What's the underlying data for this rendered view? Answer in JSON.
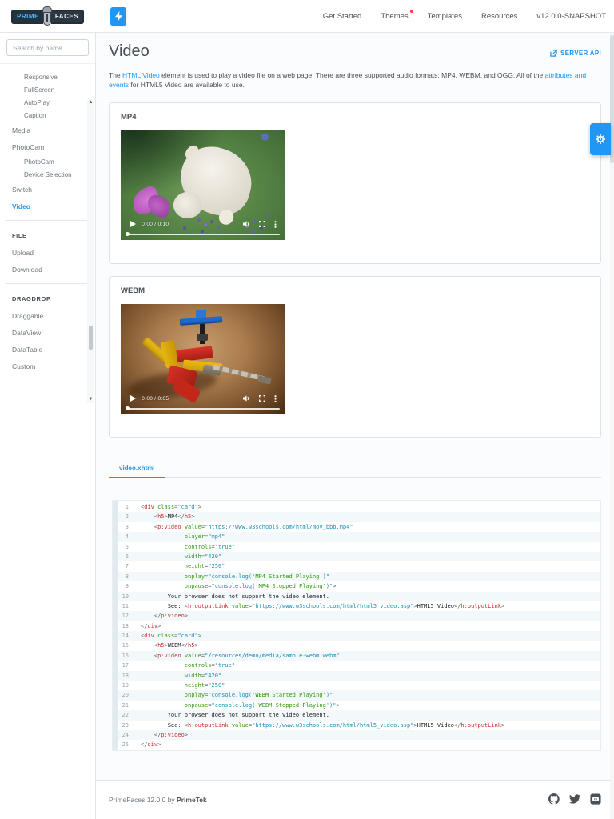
{
  "topbar": {
    "logo": {
      "prime": "PRIME",
      "faces": "FACES"
    },
    "nav": [
      {
        "label": "Get Started"
      },
      {
        "label": "Themes",
        "badge": true
      },
      {
        "label": "Templates"
      },
      {
        "label": "Resources"
      },
      {
        "label": "v12.0.0-SNAPSHOT"
      }
    ]
  },
  "sidebar": {
    "search_placeholder": "Search by name...",
    "items": [
      {
        "type": "sub",
        "label": "Responsive"
      },
      {
        "type": "sub",
        "label": "FullScreen"
      },
      {
        "type": "sub",
        "label": "AutoPlay"
      },
      {
        "type": "sub",
        "label": "Caption"
      },
      {
        "type": "top",
        "label": "Media"
      },
      {
        "type": "top",
        "label": "PhotoCam"
      },
      {
        "type": "sub",
        "label": "PhotoCam"
      },
      {
        "type": "sub",
        "label": "Device Selection"
      },
      {
        "type": "top",
        "label": "Switch"
      },
      {
        "type": "top",
        "label": "Video",
        "active": true
      },
      {
        "type": "divider"
      },
      {
        "type": "section",
        "label": "FILE"
      },
      {
        "type": "top",
        "label": "Upload"
      },
      {
        "type": "top",
        "label": "Download"
      },
      {
        "type": "divider"
      },
      {
        "type": "section",
        "label": "DRAGDROP"
      },
      {
        "type": "top",
        "label": "Draggable"
      },
      {
        "type": "top",
        "label": "DataView"
      },
      {
        "type": "top",
        "label": "DataTable"
      },
      {
        "type": "top",
        "label": "Custom"
      }
    ]
  },
  "page": {
    "title": "Video",
    "server_api_label": "SERVER API",
    "description_segments": [
      {
        "text": "The ",
        "link": false
      },
      {
        "text": "HTML Video",
        "link": true
      },
      {
        "text": " element is used to play a video file on a web page. There are three supported audio formats: MP4, WEBM, and OGG. All of the ",
        "link": false
      },
      {
        "text": "attributes and events",
        "link": true
      },
      {
        "text": " for HTML5 Video are available to use.",
        "link": false
      }
    ]
  },
  "cards": [
    {
      "title": "MP4",
      "time": "0:00 / 0:10"
    },
    {
      "title": "WEBM",
      "time": "0:00 / 0:05"
    }
  ],
  "code_section": {
    "tab": "video.xhtml",
    "lines": [
      [
        [
          "p",
          "<"
        ],
        [
          "t",
          "div"
        ],
        [
          "x",
          " "
        ],
        [
          "a",
          "class"
        ],
        [
          "p",
          "="
        ],
        [
          "v",
          "\"card\""
        ],
        [
          "p",
          ">"
        ]
      ],
      [
        [
          "x",
          "    "
        ],
        [
          "p",
          "<"
        ],
        [
          "t",
          "h5"
        ],
        [
          "p",
          ">"
        ],
        [
          "x",
          "MP4"
        ],
        [
          "p",
          "</"
        ],
        [
          "t",
          "h5"
        ],
        [
          "p",
          ">"
        ]
      ],
      [
        [
          "x",
          "    "
        ],
        [
          "p",
          "<"
        ],
        [
          "t",
          "p:video"
        ],
        [
          "x",
          " "
        ],
        [
          "a",
          "value"
        ],
        [
          "p",
          "="
        ],
        [
          "v",
          "\"https://www.w3schools.com/html/mov_bbb.mp4\""
        ]
      ],
      [
        [
          "x",
          "             "
        ],
        [
          "a",
          "player"
        ],
        [
          "p",
          "="
        ],
        [
          "v",
          "\"mp4\""
        ]
      ],
      [
        [
          "x",
          "             "
        ],
        [
          "a",
          "controls"
        ],
        [
          "p",
          "="
        ],
        [
          "v",
          "\"true\""
        ]
      ],
      [
        [
          "x",
          "             "
        ],
        [
          "a",
          "width"
        ],
        [
          "p",
          "="
        ],
        [
          "v",
          "\"420\""
        ]
      ],
      [
        [
          "x",
          "             "
        ],
        [
          "a",
          "height"
        ],
        [
          "p",
          "="
        ],
        [
          "v",
          "\"250\""
        ]
      ],
      [
        [
          "x",
          "             "
        ],
        [
          "a",
          "onplay"
        ],
        [
          "p",
          "="
        ],
        [
          "v",
          "\"console.log("
        ],
        [
          "s",
          "'MP4 Started Playing'"
        ],
        [
          "v",
          ")\""
        ]
      ],
      [
        [
          "x",
          "             "
        ],
        [
          "a",
          "onpause"
        ],
        [
          "p",
          "="
        ],
        [
          "v",
          "\"console.log("
        ],
        [
          "s",
          "'MP4 Stopped Playing'"
        ],
        [
          "v",
          ")\""
        ],
        [
          "p",
          ">"
        ]
      ],
      [
        [
          "x",
          "        Your browser does not support the video element."
        ]
      ],
      [
        [
          "x",
          "        See: "
        ],
        [
          "p",
          "<"
        ],
        [
          "t",
          "h:outputLink"
        ],
        [
          "x",
          " "
        ],
        [
          "a",
          "value"
        ],
        [
          "p",
          "="
        ],
        [
          "v",
          "\"https://www.w3schools.com/html/html5_video.asp\""
        ],
        [
          "p",
          ">"
        ],
        [
          "x",
          "HTML5 Video"
        ],
        [
          "p",
          "</"
        ],
        [
          "t",
          "h:outputLink"
        ],
        [
          "p",
          ">"
        ]
      ],
      [
        [
          "x",
          "    "
        ],
        [
          "p",
          "</"
        ],
        [
          "t",
          "p:video"
        ],
        [
          "p",
          ">"
        ]
      ],
      [
        [
          "p",
          "</"
        ],
        [
          "t",
          "div"
        ],
        [
          "p",
          ">"
        ]
      ],
      [
        [
          "p",
          "<"
        ],
        [
          "t",
          "div"
        ],
        [
          "x",
          " "
        ],
        [
          "a",
          "class"
        ],
        [
          "p",
          "="
        ],
        [
          "v",
          "\"card\""
        ],
        [
          "p",
          ">"
        ]
      ],
      [
        [
          "x",
          "    "
        ],
        [
          "p",
          "<"
        ],
        [
          "t",
          "h5"
        ],
        [
          "p",
          ">"
        ],
        [
          "x",
          "WEBM"
        ],
        [
          "p",
          "</"
        ],
        [
          "t",
          "h5"
        ],
        [
          "p",
          ">"
        ]
      ],
      [
        [
          "x",
          "    "
        ],
        [
          "p",
          "<"
        ],
        [
          "t",
          "p:video"
        ],
        [
          "x",
          " "
        ],
        [
          "a",
          "value"
        ],
        [
          "p",
          "="
        ],
        [
          "v",
          "\"/resources/demo/media/sample-webm.webm\""
        ]
      ],
      [
        [
          "x",
          "             "
        ],
        [
          "a",
          "controls"
        ],
        [
          "p",
          "="
        ],
        [
          "v",
          "\"true\""
        ]
      ],
      [
        [
          "x",
          "             "
        ],
        [
          "a",
          "width"
        ],
        [
          "p",
          "="
        ],
        [
          "v",
          "\"420\""
        ]
      ],
      [
        [
          "x",
          "             "
        ],
        [
          "a",
          "height"
        ],
        [
          "p",
          "="
        ],
        [
          "v",
          "\"250\""
        ]
      ],
      [
        [
          "x",
          "             "
        ],
        [
          "a",
          "onplay"
        ],
        [
          "p",
          "="
        ],
        [
          "v",
          "\"console.log("
        ],
        [
          "s",
          "'WEBM Started Playing'"
        ],
        [
          "v",
          ")\""
        ]
      ],
      [
        [
          "x",
          "             "
        ],
        [
          "a",
          "onpause"
        ],
        [
          "p",
          "="
        ],
        [
          "v",
          "\"console.log("
        ],
        [
          "s",
          "'WEBM Stopped Playing'"
        ],
        [
          "v",
          ")\""
        ],
        [
          "p",
          ">"
        ]
      ],
      [
        [
          "x",
          "        Your browser does not support the video element."
        ]
      ],
      [
        [
          "x",
          "        See: "
        ],
        [
          "p",
          "<"
        ],
        [
          "t",
          "h:outputLink"
        ],
        [
          "x",
          " "
        ],
        [
          "a",
          "value"
        ],
        [
          "p",
          "="
        ],
        [
          "v",
          "\"https://www.w3schools.com/html/html5_video.asp\""
        ],
        [
          "p",
          ">"
        ],
        [
          "x",
          "HTML5 Video"
        ],
        [
          "p",
          "</"
        ],
        [
          "t",
          "h:outputLink"
        ],
        [
          "p",
          ">"
        ]
      ],
      [
        [
          "x",
          "    "
        ],
        [
          "p",
          "</"
        ],
        [
          "t",
          "p:video"
        ],
        [
          "p",
          ">"
        ]
      ],
      [
        [
          "p",
          "</"
        ],
        [
          "t",
          "div"
        ],
        [
          "p",
          ">"
        ]
      ]
    ]
  },
  "footer": {
    "text": "PrimeFaces 12.0.0 by ",
    "brand": "PrimeTek"
  },
  "colors": {
    "accent": "#2196F3",
    "badge": "#f44336",
    "code_tag": "#c92c2c",
    "code_attr_name": "#2f9c0a",
    "code_attr_value": "#1990b8",
    "code_punctuation": "#5F6364"
  }
}
